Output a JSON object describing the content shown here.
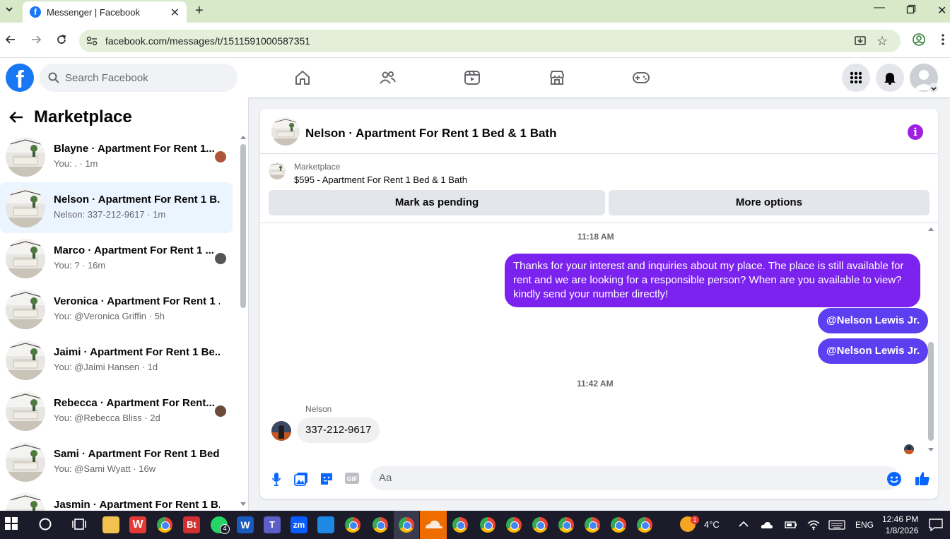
{
  "browser": {
    "tab_title": "Messenger | Facebook",
    "url": "facebook.com/messages/t/1511591000587351"
  },
  "fb": {
    "search_placeholder": "Search Facebook"
  },
  "sidebar": {
    "title": "Marketplace",
    "conversations": [
      {
        "name": "Blayne · Apartment For Rent 1...",
        "preview": "You: . · 1m",
        "active": false
      },
      {
        "name": "Nelson · Apartment For Rent 1 B...",
        "preview": "Nelson: 337-212-9617 · 1m",
        "active": true
      },
      {
        "name": "Marco · Apartment For Rent 1 ...",
        "preview": "You: ? · 16m",
        "active": false
      },
      {
        "name": "Veronica · Apartment For Rent 1 ...",
        "preview": "You: @Veronica Griffin · 5h",
        "active": false
      },
      {
        "name": "Jaimi · Apartment For Rent 1 Be...",
        "preview": "You: @Jaimi Hansen · 1d",
        "active": false
      },
      {
        "name": "Rebecca · Apartment For Rent...",
        "preview": "You: @Rebecca Bliss · 2d",
        "active": false
      },
      {
        "name": "Sami · Apartment For Rent 1 Bed...",
        "preview": "You: @Sami Wyatt · 16w",
        "active": false
      },
      {
        "name": "Jasmin · Apartment For Rent 1 B...",
        "preview": "",
        "active": false
      }
    ]
  },
  "chat": {
    "title": "Nelson · Apartment For Rent 1 Bed & 1 Bath",
    "marketplace_label": "Marketplace",
    "listing": "$595 - Apartment For Rent 1 Bed & 1 Bath",
    "btn_pending": "Mark as pending",
    "btn_more": "More options",
    "time1": "11:18 AM",
    "msg_out": "Thanks for your interest and inquiries about my place. The place is still available for rent and we are looking for a responsible person? When are you available to view? kindly send your number directly!",
    "mention1": "@Nelson Lewis Jr.",
    "mention2": "@Nelson Lewis Jr.",
    "time2": "11:42 AM",
    "incoming_name": "Nelson",
    "incoming_msg": "337-212-9617",
    "input_placeholder": "Aa"
  },
  "taskbar": {
    "whatsapp_badge": "4",
    "weather": "4°C",
    "weather_badge": "1",
    "lang": "ENG",
    "time": "12:46 PM",
    "date": "1/8/2026"
  },
  "colors": {
    "fb_blue": "#1877f2",
    "out_bubble": "#7b22ee",
    "mention": "#5b3ff0",
    "accent": "#a01fe0"
  }
}
